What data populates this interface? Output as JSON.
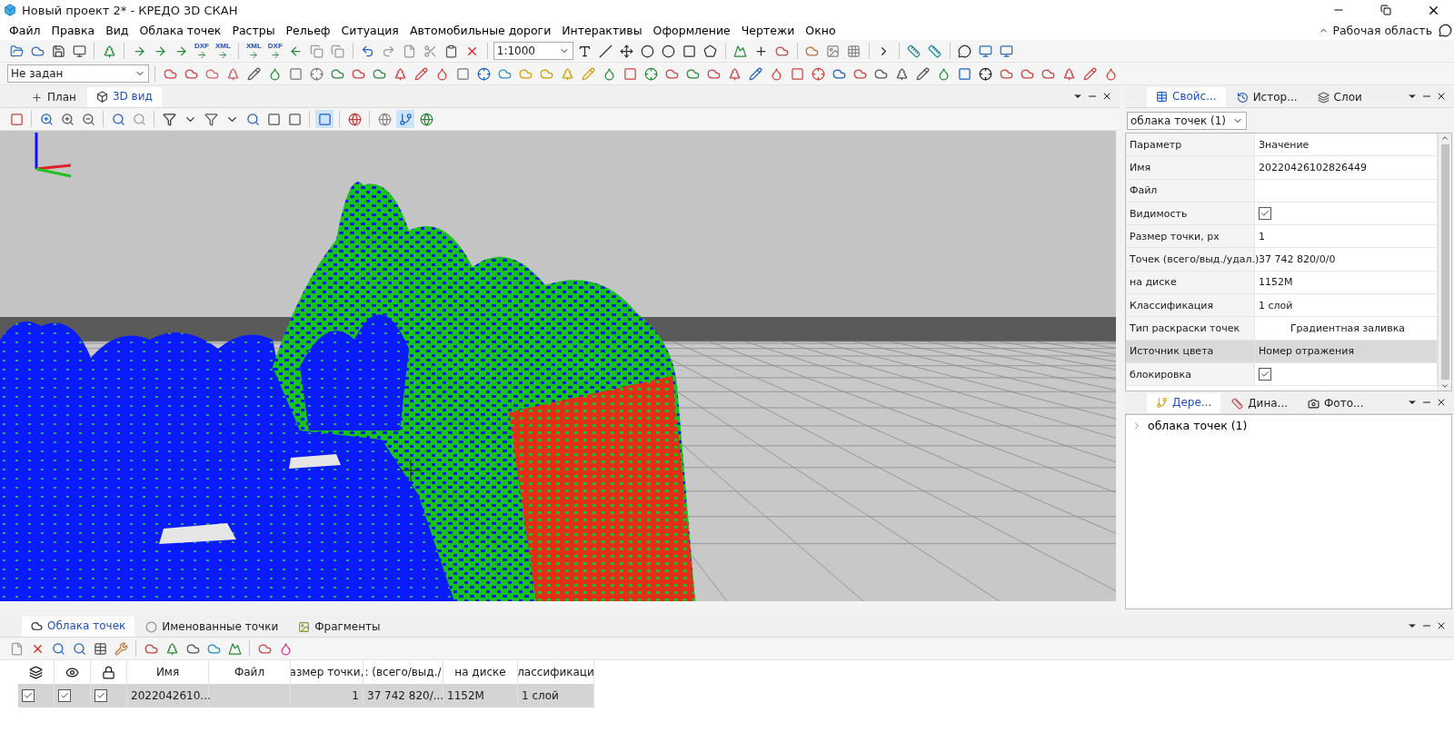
{
  "window": {
    "title": "Новый проект 2* - КРЕДО 3D СКАН"
  },
  "menu": [
    "Файл",
    "Правка",
    "Вид",
    "Облака точек",
    "Растры",
    "Рельеф",
    "Ситуация",
    "Автомобильные дороги",
    "Интерактивы",
    "Оформление",
    "Чертежи",
    "Окно"
  ],
  "workspace": {
    "label": "Рабочая область"
  },
  "toolbar": {
    "formats": [
      "DXF",
      "XML",
      "XML",
      "DXF"
    ],
    "scale": "1:1000",
    "layer_select": "Не задан"
  },
  "view_tabs": [
    {
      "label": "План",
      "selected": false
    },
    {
      "label": "3D вид",
      "selected": true
    }
  ],
  "properties": {
    "tabs": [
      {
        "label": "Свойс...",
        "selected": true
      },
      {
        "label": "Истор...",
        "selected": false
      },
      {
        "label": "Слои",
        "selected": false
      }
    ],
    "object_select": "облака точек (1)",
    "columns": [
      "Параметр",
      "Значение"
    ],
    "rows": [
      {
        "name": "Имя",
        "kind": "text",
        "value": "20220426102826449",
        "selected": false
      },
      {
        "name": "Файл",
        "kind": "text",
        "selected": false
      },
      {
        "name": "Видимость",
        "kind": "check",
        "checked": true,
        "selected": false
      },
      {
        "name": "Размер точки, px",
        "kind": "text",
        "value": "1",
        "selected": false
      },
      {
        "name": "Точек (всего/выд./удал.)",
        "kind": "text",
        "value": "37 742 820/0/0",
        "selected": false
      },
      {
        "name": "на диске",
        "kind": "text",
        "value": "1152M",
        "selected": false
      },
      {
        "name": "Классификация",
        "kind": "text",
        "value": "1 слой",
        "selected": false
      },
      {
        "name": "Тип раскраски точек",
        "kind": "combo",
        "value": "Градиентная заливка",
        "selected": false
      },
      {
        "name": "Источник цвета",
        "kind": "text",
        "value": "Номер отражения",
        "selected": true
      },
      {
        "name": "блокировка",
        "kind": "check",
        "checked": true,
        "selected": false
      }
    ]
  },
  "tree_panel": {
    "tabs": [
      {
        "label": "Дере...",
        "selected": true
      },
      {
        "label": "Дина...",
        "selected": false
      },
      {
        "label": "Фото...",
        "selected": false
      }
    ],
    "items": [
      {
        "label": "облака точек (1)",
        "expanded": false
      }
    ]
  },
  "bottom": {
    "tabs": [
      {
        "label": "Облака точек",
        "selected": true
      },
      {
        "label": "Именованные точки",
        "selected": false
      },
      {
        "label": "Фрагменты",
        "selected": false
      }
    ],
    "columns": [
      "Имя",
      "Файл",
      "азмер точки,",
      ": (всего/выд./",
      "на диске",
      "лассификаци"
    ],
    "rows": [
      {
        "layer_on": true,
        "visible": true,
        "locked": true,
        "name": "2022042610...",
        "size": "1",
        "points": "37 742 820/...",
        "disk": "1152M",
        "classification": "1 слой",
        "selected": true
      }
    ]
  }
}
